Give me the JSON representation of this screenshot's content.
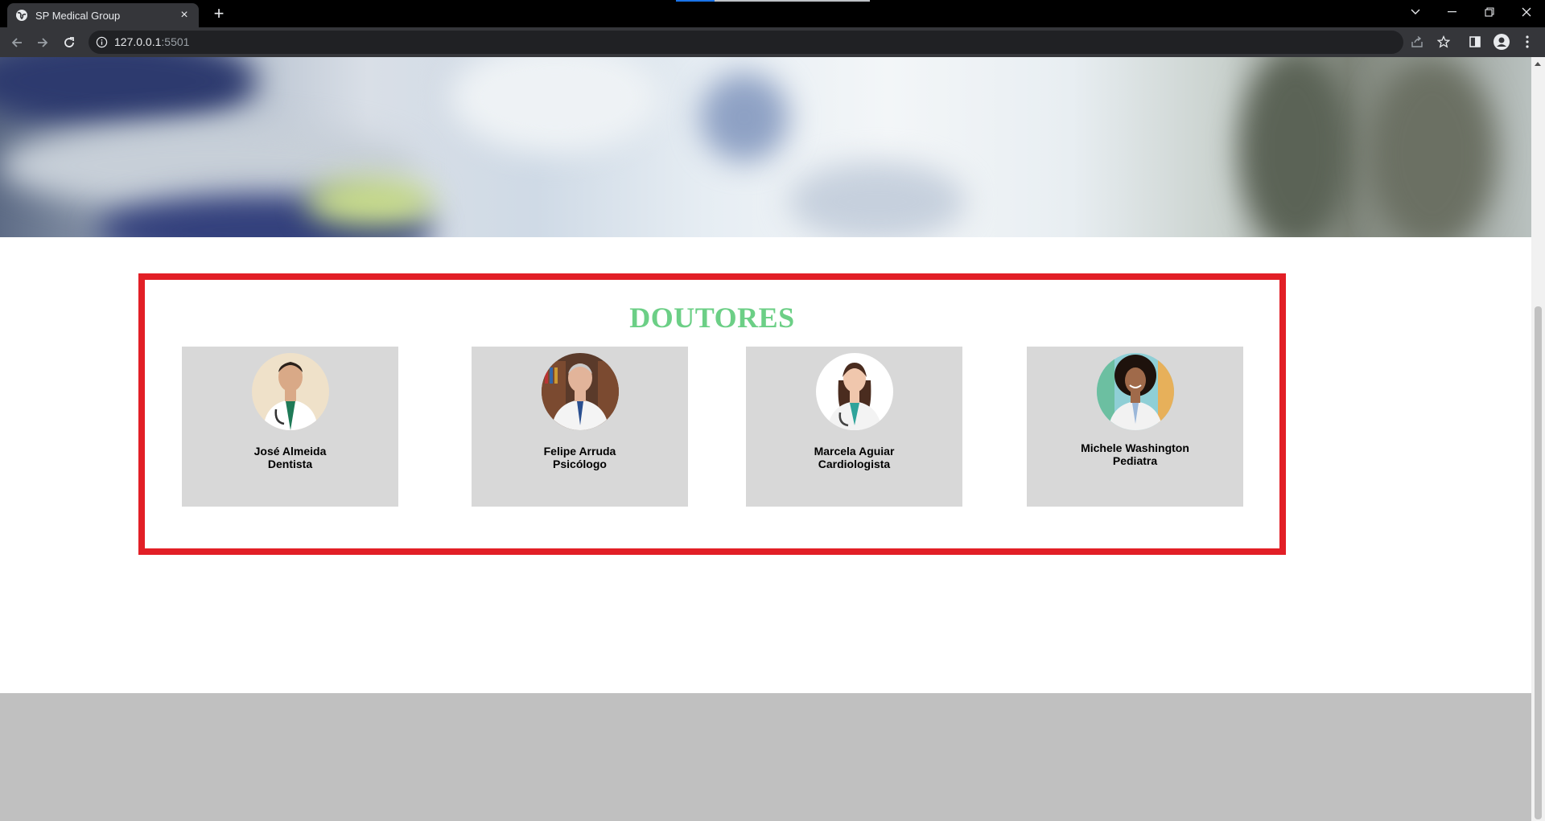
{
  "browser": {
    "tab_title": "SP Medical Group",
    "url_host": "127.0.0.1",
    "url_port": ":5501",
    "new_tab_label": "+",
    "tab_close_label": "×",
    "colors": {
      "tabstrip": "#000000",
      "toolbar": "#35363a",
      "omnibox": "#202124"
    }
  },
  "page": {
    "section_title": "DOUTORES",
    "colors": {
      "title": "#6ccf86",
      "frame": "#e21f26",
      "card": "#d8d8d8",
      "footer": "#c0c0c0"
    },
    "doctors": [
      {
        "name": "José Almeida",
        "specialty": "Dentista"
      },
      {
        "name": "Felipe Arruda",
        "specialty": "Psicólogo"
      },
      {
        "name": "Marcela Aguiar",
        "specialty": "Cardiologista"
      },
      {
        "name": "Michele Washington",
        "specialty": "Pediatra"
      }
    ]
  }
}
